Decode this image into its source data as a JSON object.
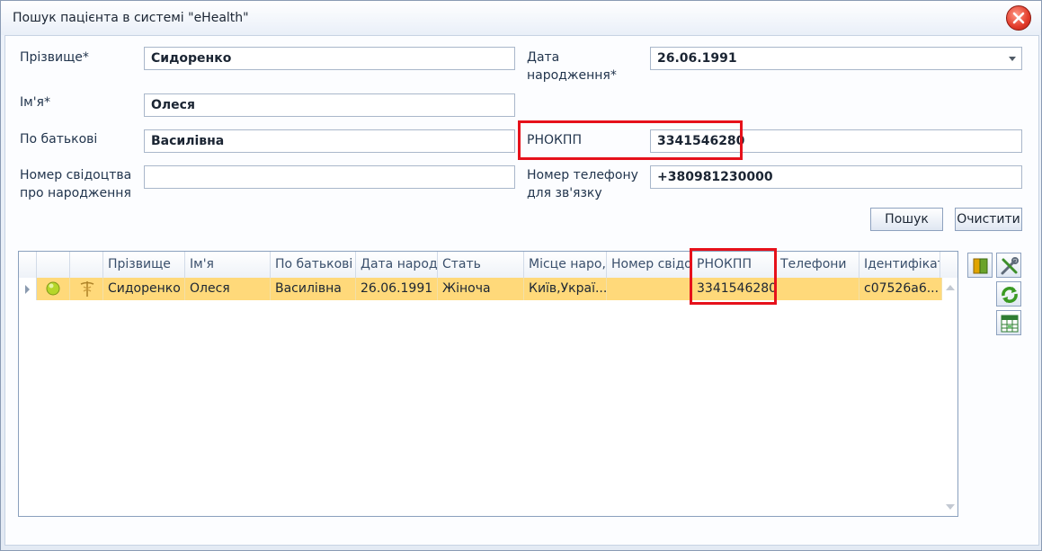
{
  "window": {
    "title": "Пошук пацієнта в системі \"eHealth\""
  },
  "form": {
    "surname_label": "Прізвище*",
    "surname_value": "Сидоренко",
    "name_label": "Ім'я*",
    "name_value": "Олеся",
    "patronymic_label": "По батькові",
    "patronymic_value": "Василівна",
    "birth_cert_label": "Номер свідоцтва про народження",
    "birth_cert_value": "",
    "birthdate_label": "Дата народження*",
    "birthdate_value": "26.06.1991",
    "rnokpp_label": "РНОКПП",
    "rnokpp_value": "3341546280",
    "phone_label": "Номер телефону для зв'язку",
    "phone_value": "+380981230000",
    "search_button": "Пошук",
    "clear_button": "Очистити"
  },
  "grid": {
    "columns": [
      "Прізвище",
      "Ім'я",
      "По батькові",
      "Дата народж",
      "Стать",
      "Місце наро,",
      "Номер свідо",
      "РНОКПП",
      "Телефони",
      "Ідентифікат"
    ],
    "rows": [
      [
        "Сидоренко",
        "Олеся",
        "Василівна",
        "26.06.1991",
        "Жіноча",
        "Київ,Украї...",
        "",
        "3341546280",
        "",
        "c07526a6..."
      ]
    ]
  },
  "colors": {
    "highlight": "#e6111b",
    "selected_row": "#ffd97a",
    "status_dot": "#b6d62a"
  },
  "icons": [
    "close-icon",
    "dropdown-arrow-icon",
    "row-pointer-icon",
    "status-dot-icon",
    "caduceus-icon",
    "book-icon",
    "tools-icon",
    "refresh-icon",
    "excel-export-icon",
    "scroll-up-icon",
    "scroll-down-icon"
  ]
}
